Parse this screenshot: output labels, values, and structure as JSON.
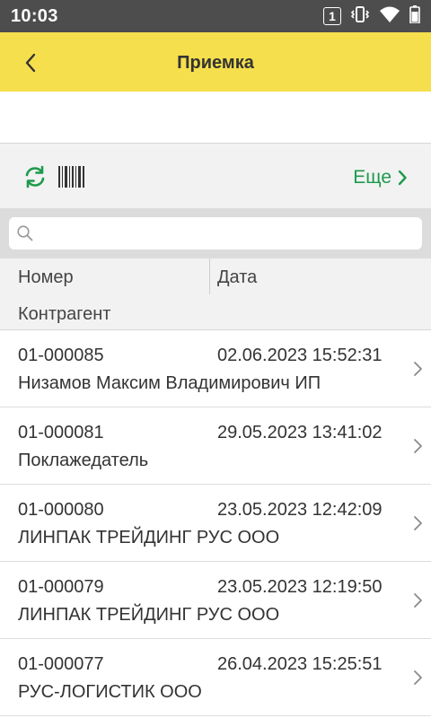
{
  "status_bar": {
    "time": "10:03",
    "sim_slot": "1",
    "icons": [
      "sim-slot-icon",
      "vibrate-icon",
      "wifi-icon",
      "battery-icon"
    ],
    "background": "#4d4d4d"
  },
  "header": {
    "title": "Приемка",
    "back_icon": "chevron-left-icon",
    "background": "#f5df4d"
  },
  "toolbar": {
    "refresh_icon": "refresh-icon",
    "barcode_icon": "barcode-icon",
    "more_label": "Еще",
    "more_icon": "chevron-right-icon",
    "accent": "#1d9a4c"
  },
  "search": {
    "icon": "search-icon",
    "value": "",
    "placeholder": ""
  },
  "columns": {
    "number": "Номер",
    "date": "Дата",
    "contractor": "Контрагент"
  },
  "documents": [
    {
      "number": "01-000085",
      "date": "02.06.2023 15:52:31",
      "contractor": "Низамов Максим Владимирович ИП"
    },
    {
      "number": "01-000081",
      "date": "29.05.2023 13:41:02",
      "contractor": "Поклажедатель"
    },
    {
      "number": "01-000080",
      "date": "23.05.2023 12:42:09",
      "contractor": "ЛИНПАК ТРЕЙДИНГ РУС ООО"
    },
    {
      "number": "01-000079",
      "date": "23.05.2023 12:19:50",
      "contractor": "ЛИНПАК ТРЕЙДИНГ РУС ООО"
    },
    {
      "number": "01-000077",
      "date": "26.04.2023 15:25:51",
      "contractor": "РУС-ЛОГИСТИК ООО"
    }
  ]
}
